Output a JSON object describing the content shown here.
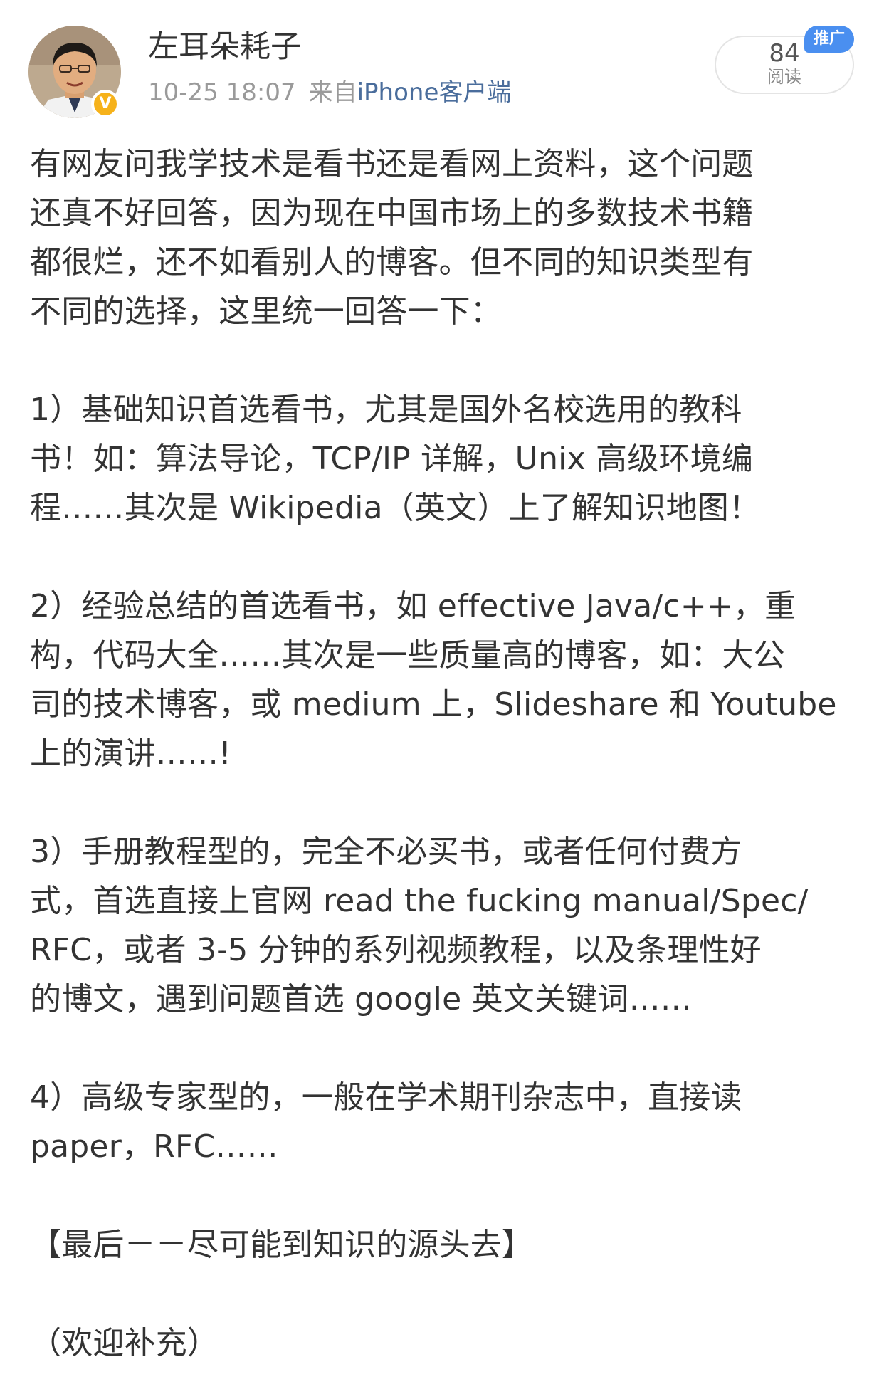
{
  "header": {
    "author_name": "左耳朵耗子",
    "timestamp": "10-25 18:07",
    "source_prefix": "来自",
    "source_name": "iPhone客户端",
    "verified_mark": "V",
    "read_count": "84",
    "read_label": "阅读",
    "promo_label": "推广"
  },
  "post": {
    "lines": [
      "有网友问我学技术是看书还是看网上资料，这个问题",
      "还真不好回答，因为现在中国市场上的多数技术书籍",
      "都很烂，还不如看别人的博客。但不同的知识类型有",
      "不同的选择，这里统一回答一下：",
      "",
      "1）基础知识首选看书，尤其是国外名校选用的教科",
      "书！如：算法导论，TCP/IP 详解，Unix 高级环境编",
      "程……其次是 Wikipedia（英文）上了解知识地图！",
      "",
      "2）经验总结的首选看书，如 effective Java/c++，重",
      "构，代码大全……其次是一些质量高的博客，如：大公",
      "司的技术博客，或 medium 上，Slideshare 和 Youtube",
      "上的演讲……!",
      "",
      "3）手册教程型的，完全不必买书，或者任何付费方",
      "式，首选直接上官网 read the fucking manual/Spec/",
      "RFC，或者 3-5 分钟的系列视频教程，以及条理性好",
      "的博文，遇到问题首选 google 英文关键词……",
      "",
      "4）高级专家型的，一般在学术期刊杂志中，直接读",
      "paper，RFC……",
      "",
      "【最后－－尽可能到知识的源头去】",
      "",
      "（欢迎补充）"
    ]
  },
  "colors": {
    "text": "#333333",
    "meta_gray": "#9a9a9a",
    "link_blue": "#4a6d9c",
    "verified_gold": "#f6b21b",
    "promo_blue": "#4a8ff0"
  }
}
